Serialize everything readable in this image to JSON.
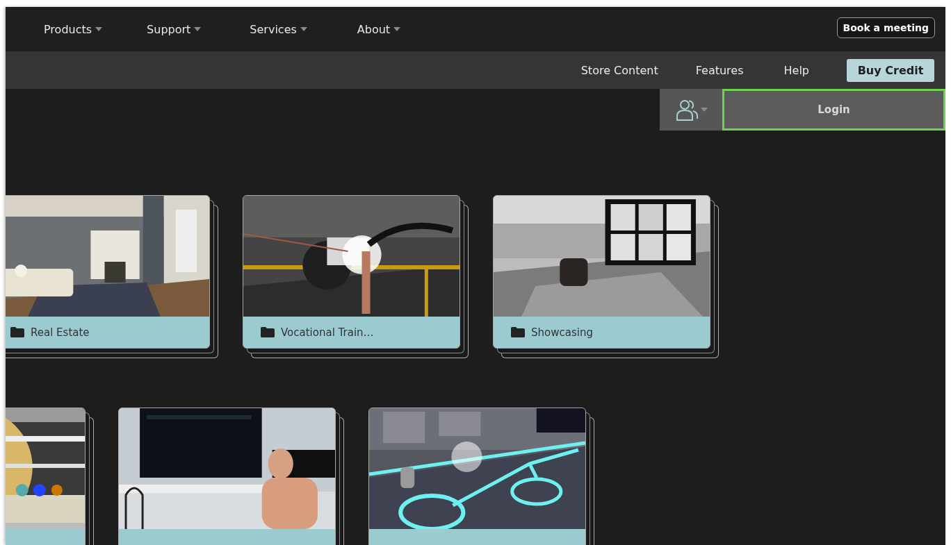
{
  "nav": {
    "items": [
      {
        "label": "Products",
        "dropdown": true
      },
      {
        "label": "Support",
        "dropdown": true
      },
      {
        "label": "Services",
        "dropdown": true
      },
      {
        "label": "About",
        "dropdown": true
      }
    ],
    "book_button": "Book a meeting"
  },
  "subnav": {
    "links": [
      "Store Content",
      "Features",
      "Help"
    ],
    "buy_button": "Buy Credit"
  },
  "account": {
    "user_menu": {
      "dropdown": true
    },
    "login": {
      "label": "Login",
      "focused": true
    }
  },
  "rows": [
    {
      "cards": [
        {
          "title": "Real Estate",
          "picture": {
            "kind": "picture"
          }
        },
        {
          "title": "Vocational Train…",
          "picture": {
            "kind": "picture"
          }
        },
        {
          "title": "Showcasing",
          "picture": {
            "kind": "picture"
          }
        }
      ]
    },
    {
      "cards": [
        {
          "picture": {
            "kind": "picture"
          }
        },
        {
          "picture": {
            "kind": "picture"
          }
        },
        {
          "picture": {
            "kind": "picture"
          }
        }
      ]
    }
  ]
}
